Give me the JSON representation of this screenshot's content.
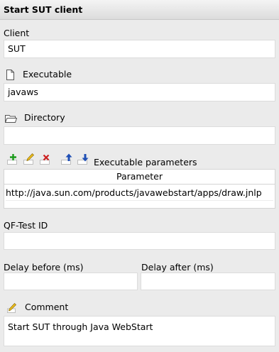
{
  "header": {
    "title": "Start SUT client"
  },
  "client": {
    "label": "Client",
    "value": "SUT"
  },
  "executable": {
    "label": "Executable",
    "value": "javaws",
    "icon": "file-icon"
  },
  "directory": {
    "label": "Directory",
    "value": "",
    "icon": "folder-icon"
  },
  "parameters": {
    "label": "Executable parameters",
    "toolbar": [
      "add-row-icon",
      "edit-row-icon",
      "delete-row-icon",
      "move-up-icon",
      "move-down-icon"
    ],
    "column_header": "Parameter",
    "rows": [
      "http://java.sun.com/products/javawebstart/apps/draw.jnlp"
    ]
  },
  "qftest_id": {
    "label": "QF-Test ID",
    "value": ""
  },
  "delay_before": {
    "label": "Delay before (ms)",
    "value": ""
  },
  "delay_after": {
    "label": "Delay after (ms)",
    "value": ""
  },
  "comment": {
    "label": "Comment",
    "value": "Start SUT through Java WebStart",
    "icon": "pencil-icon"
  },
  "colors": {
    "add": "#1a9a1a",
    "delete": "#cc2020",
    "arrow": "#1f4fb5",
    "pencil": "#f0c020"
  }
}
